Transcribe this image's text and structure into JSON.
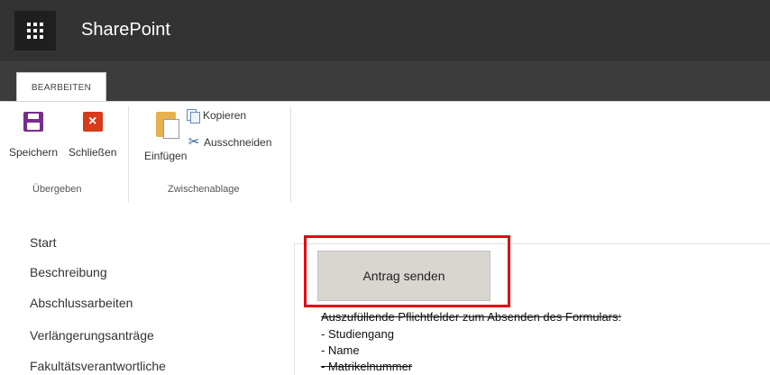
{
  "suite_bar": {
    "app_name": "SharePoint",
    "waffle_icon": "waffle-icon"
  },
  "ribbon": {
    "tab_label": "BEARBEITEN",
    "buttons": {
      "save": "Speichern",
      "close": "Schließen",
      "paste": "Einfügen",
      "copy": "Kopieren",
      "cut": "Ausschneiden"
    },
    "groups": {
      "commit": "Übergeben",
      "clipboard": "Zwischenablage"
    }
  },
  "nav": {
    "items": [
      {
        "label": "Start"
      },
      {
        "label": "Beschreibung"
      },
      {
        "label": "Abschlussarbeiten"
      },
      {
        "label": "Verlängerungsanträge"
      },
      {
        "label": "Fakultätsverantwortliche"
      }
    ]
  },
  "content": {
    "submit_button": "Antrag senden",
    "info_heading": "Auszufüllende Pflichtfelder zum Absenden des Formulars:",
    "required_fields": [
      "- Studiengang",
      "- Name",
      "- Matrikelnummer"
    ]
  },
  "colors": {
    "suite_bar": "#333333",
    "ribbon_strip": "#3c3c3c",
    "highlight": "#e30613",
    "save_icon": "#7a2b8e",
    "close_icon": "#d83b1a"
  }
}
